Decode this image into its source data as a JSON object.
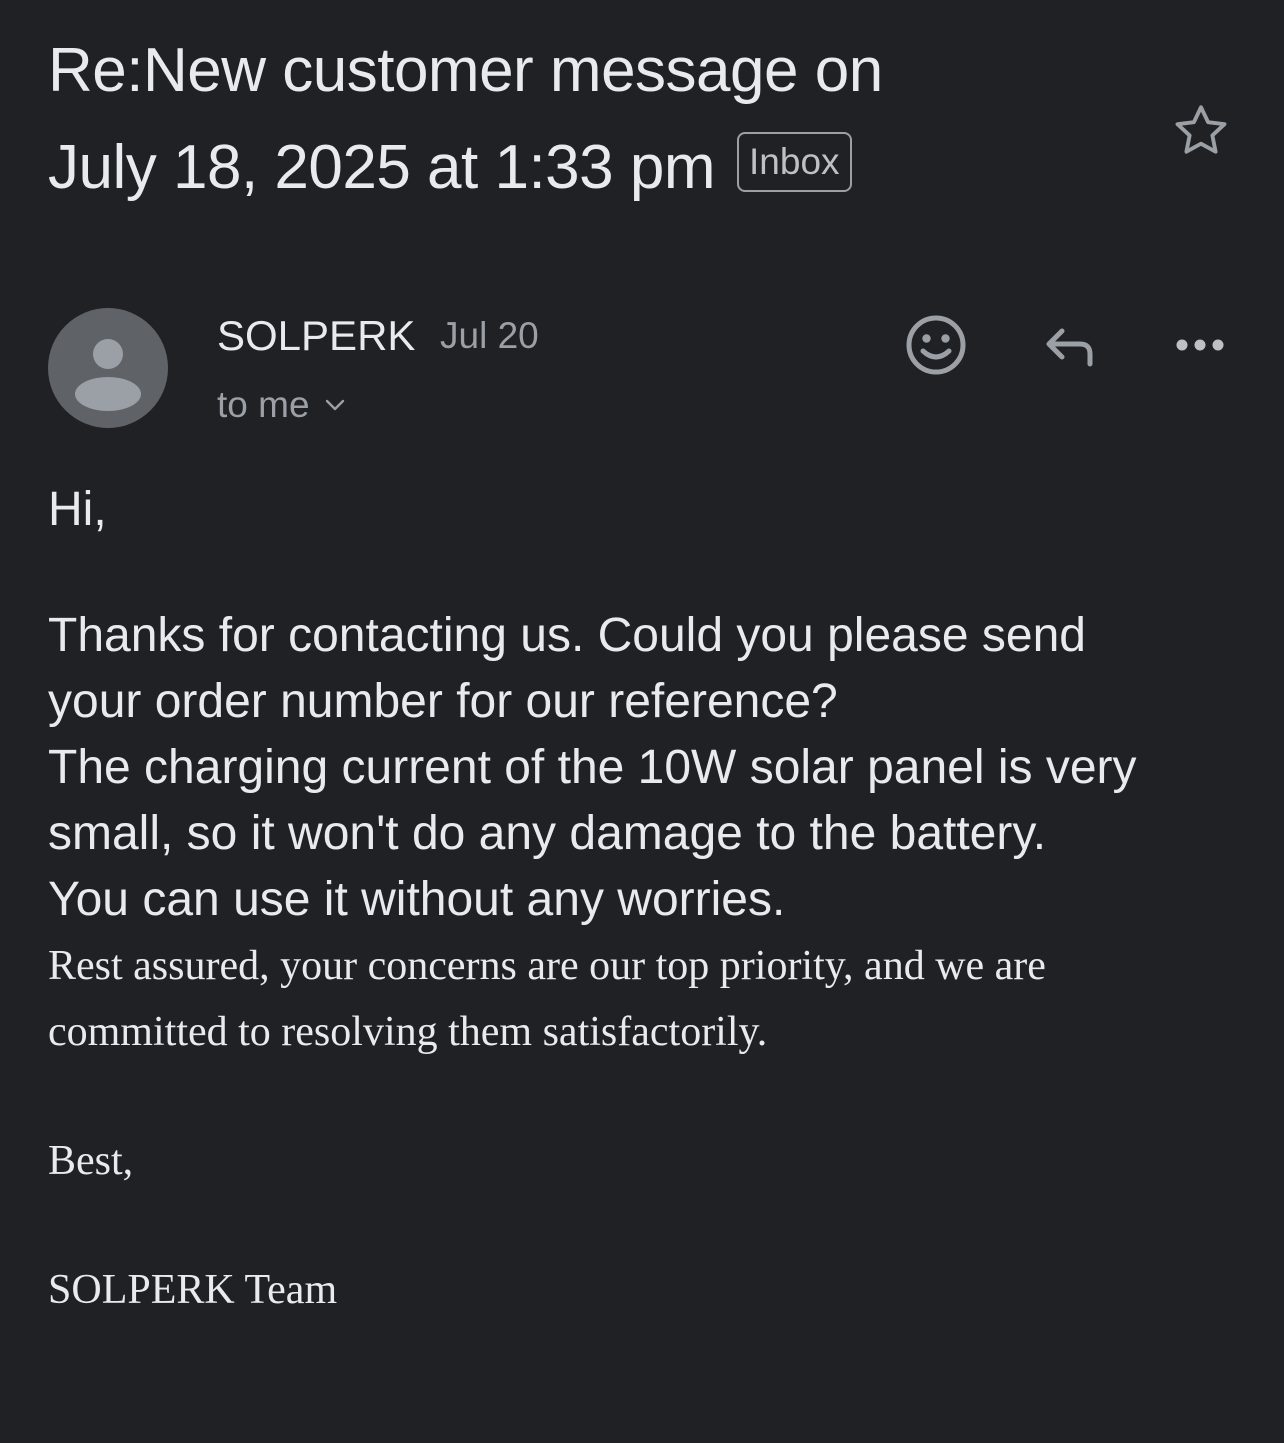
{
  "email": {
    "subject_line1": "Re:New customer message on",
    "subject_line2": "July 18, 2025 at 1:33 pm",
    "label": "Inbox",
    "sender": "SOLPERK",
    "date": "Jul 20",
    "recipient": "to me",
    "body": {
      "greeting": "Hi,",
      "p1_line1": "Thanks for contacting us. Could you please send",
      "p1_line2": "your order number for our reference?",
      "p1_line3": "The charging current of the 10W solar panel is very",
      "p1_line4": "small, so it won't do any damage to the battery.",
      "p1_line5": "You can use it without any worries.",
      "p2_line1": "Rest assured, your concerns are our top priority, and we are",
      "p2_line2": "committed to resolving them satisfactorily.",
      "closing": "Best,",
      "signature": "SOLPERK Team"
    }
  },
  "icons": {
    "star": "star-outline-icon",
    "avatar": "person-icon",
    "emoji": "emoji-reaction-icon",
    "reply": "reply-icon",
    "more": "more-horizontal-icon",
    "expand": "chevron-down-icon"
  },
  "colors": {
    "background": "#202124",
    "text_primary": "#e8eaed",
    "text_secondary": "#9aa0a6",
    "avatar_bg": "#5f6368"
  }
}
